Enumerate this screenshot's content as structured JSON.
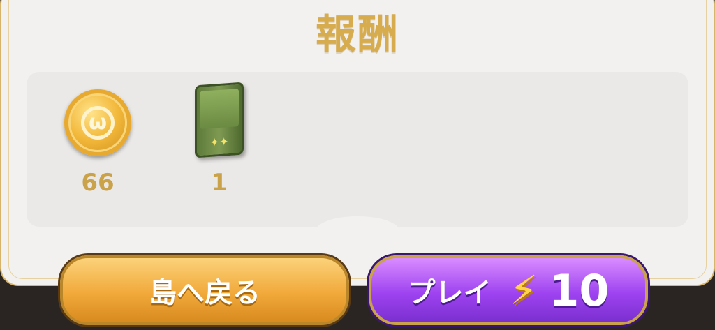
{
  "title": "報酬",
  "rewards": [
    {
      "icon": "gold-coin-icon",
      "quantity": "66"
    },
    {
      "icon": "green-card-case-icon",
      "quantity": "1"
    }
  ],
  "buttons": {
    "back_label": "島へ戻る",
    "play_label": "プレイ",
    "play_cost": "10"
  },
  "colors": {
    "title": "#d6ac4e",
    "back_button": "#f1a93a",
    "play_button": "#9e43f0"
  }
}
